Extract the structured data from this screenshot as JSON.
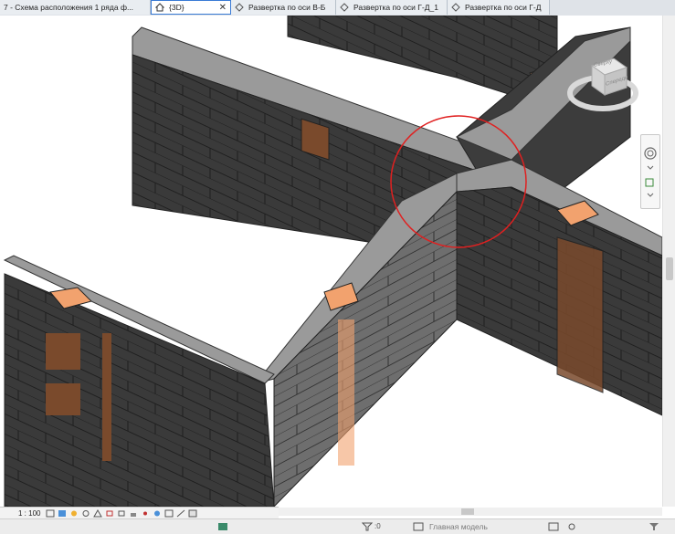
{
  "tabs": [
    {
      "label": "7 - Схема расположения 1 ряда ф...",
      "icon": "sheet-icon",
      "active": false
    },
    {
      "label": "{3D}",
      "icon": "home-3d-icon",
      "active": true,
      "close": "✕"
    },
    {
      "label": "Развертка по оси В-Б",
      "icon": "elevation-icon",
      "active": false
    },
    {
      "label": "Развертка по оси Г-Д_1",
      "icon": "elevation-icon",
      "active": false
    },
    {
      "label": "Развертка по оси Г-Д",
      "icon": "elevation-icon",
      "active": false
    }
  ],
  "viewcube": {
    "top": "Сверху",
    "front": "Спереди"
  },
  "view_controls": {
    "scale": "1 : 100"
  },
  "status": {
    "filter_count": ":0",
    "model": "Главная модель"
  },
  "colors": {
    "block_dark": "#3a3a3a",
    "block_top": "#9a9a9a",
    "block_orange": "#f2a26e",
    "block_brown": "#7a4a2c",
    "highlight_circle": "#e02020"
  }
}
